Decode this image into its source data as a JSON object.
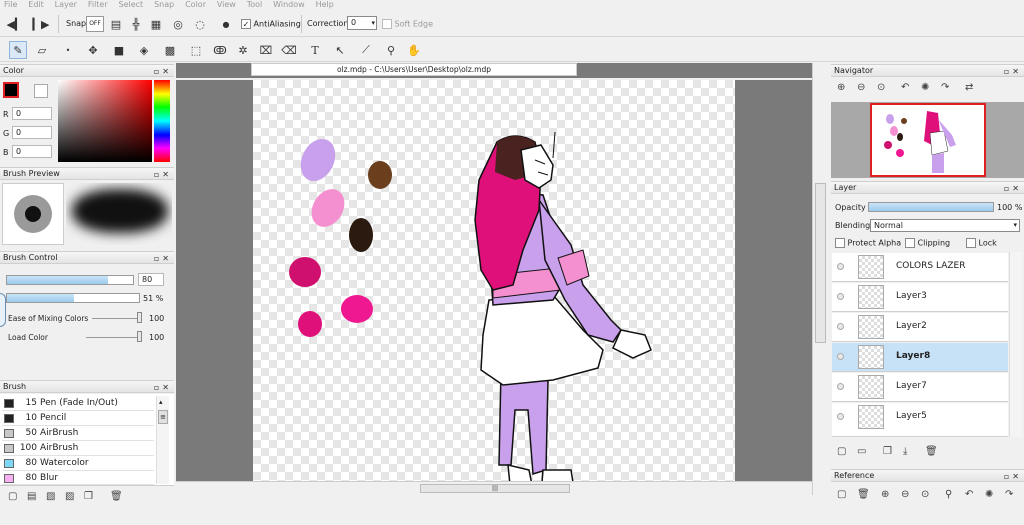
{
  "menu": [
    "File",
    "Edit",
    "Layer",
    "Filter",
    "Select",
    "Snap",
    "Color",
    "View",
    "Tool",
    "Window",
    "Help"
  ],
  "toolbar": {
    "snap_label": "Snap",
    "snap_off_label": "OFF",
    "antialiasing_label": "AntiAliasing",
    "correction_label": "Correction",
    "correction_value": "0",
    "soft_edge_label": "Soft Edge"
  },
  "document": {
    "tab_title": "olz.mdp - C:\\Users\\User\\Desktop\\olz.mdp"
  },
  "color_panel": {
    "title": "Color",
    "r_label": "R",
    "r_value": "0",
    "g_label": "G",
    "g_value": "0",
    "b_label": "B",
    "b_value": "0",
    "primary_color": "#000000"
  },
  "brush_preview": {
    "title": "Brush Preview"
  },
  "brush_control": {
    "title": "Brush Control",
    "size_value": "80",
    "size_fill": 0.8,
    "opacity_value": "51 %",
    "opacity_fill": 0.51,
    "mixing_label": "Ease of Mixing Colors",
    "mixing_value": "100",
    "load_label": "Load Color",
    "load_value": "100"
  },
  "brush_panel": {
    "title": "Brush",
    "items": [
      {
        "size": "15",
        "name": "Pen (Fade In/Out)",
        "color": "#222222"
      },
      {
        "size": "10",
        "name": "Pencil",
        "color": "#222222"
      },
      {
        "size": "50",
        "name": "AirBrush",
        "color": "#c8c8c8"
      },
      {
        "size": "100",
        "name": "AirBrush",
        "color": "#c8c8c8"
      },
      {
        "size": "80",
        "name": "Watercolor",
        "color": "#7fd7f7"
      },
      {
        "size": "80",
        "name": "Blur",
        "color": "#f7b0ef"
      }
    ]
  },
  "navigator": {
    "title": "Navigator"
  },
  "layer_panel": {
    "title": "Layer",
    "opacity_label": "Opacity",
    "opacity_value": "100 %",
    "opacity_fill": 1.0,
    "blending_label": "Blending",
    "blending_value": "Normal",
    "protect_alpha_label": "Protect Alpha",
    "clipping_label": "Clipping",
    "lock_label": "Lock",
    "layers": [
      {
        "name": "COLORS LAZER",
        "selected": false
      },
      {
        "name": "Layer3",
        "selected": false
      },
      {
        "name": "Layer2",
        "selected": false
      },
      {
        "name": "Layer8",
        "selected": true
      },
      {
        "name": "Layer7",
        "selected": false
      },
      {
        "name": "Layer5",
        "selected": false
      }
    ]
  },
  "reference": {
    "title": "Reference"
  },
  "colors": {
    "accent": "#9ccbed",
    "selection": "#c7e2f6",
    "canvas_bg": "#7a7a7a",
    "nav_frame": "#e02020",
    "lilac": "#c8a0ec",
    "pink": "#f48fd0",
    "magenta": "#e0007a",
    "brown": "#6b3e1e",
    "dark_brown": "#2a1a10"
  }
}
